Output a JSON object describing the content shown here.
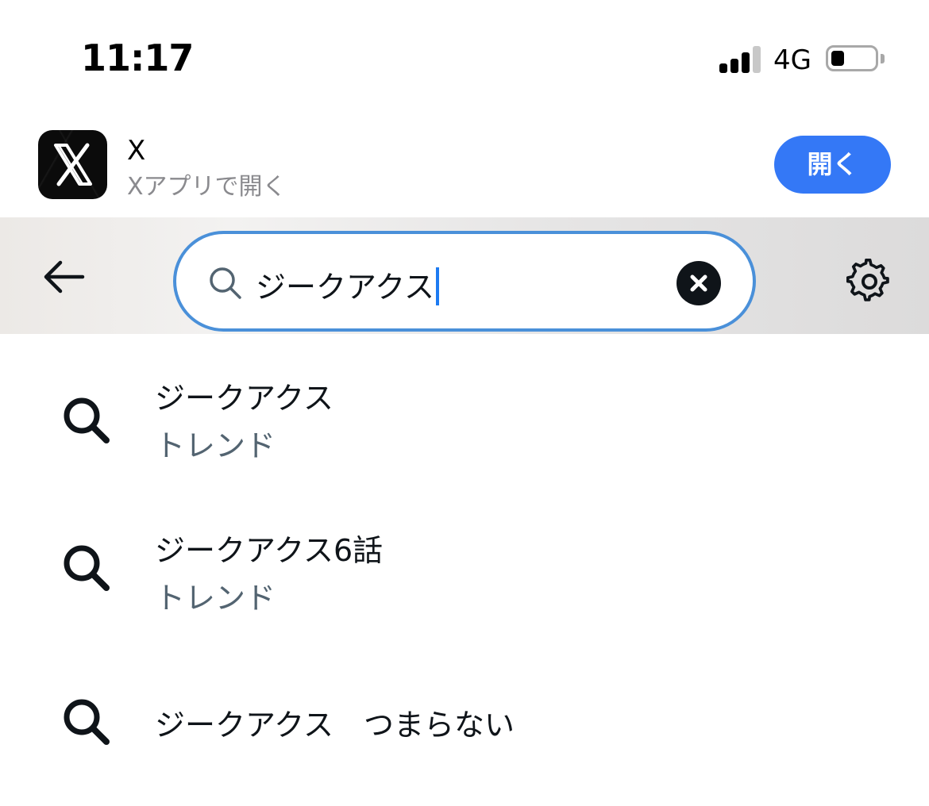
{
  "status_bar": {
    "time": "11:17",
    "network": "4G",
    "signal_bars_active": 3,
    "signal_bars_total": 4,
    "battery_level": 0.3
  },
  "app_banner": {
    "app_name": "X",
    "subtitle": "Xアプリで開く",
    "open_label": "開く",
    "accent_color": "#3478f6"
  },
  "search": {
    "query": "ジークアクス",
    "focus_color": "#4a90d9"
  },
  "suggestions": [
    {
      "title": "ジークアクス",
      "subtitle": "トレンド"
    },
    {
      "title": "ジークアクス6話",
      "subtitle": "トレンド"
    },
    {
      "title": "ジークアクス　つまらない",
      "subtitle": ""
    }
  ],
  "icons": {
    "back": "arrow-left-icon",
    "search": "magnifier-icon",
    "clear": "close-circle-icon",
    "settings": "gear-icon"
  }
}
